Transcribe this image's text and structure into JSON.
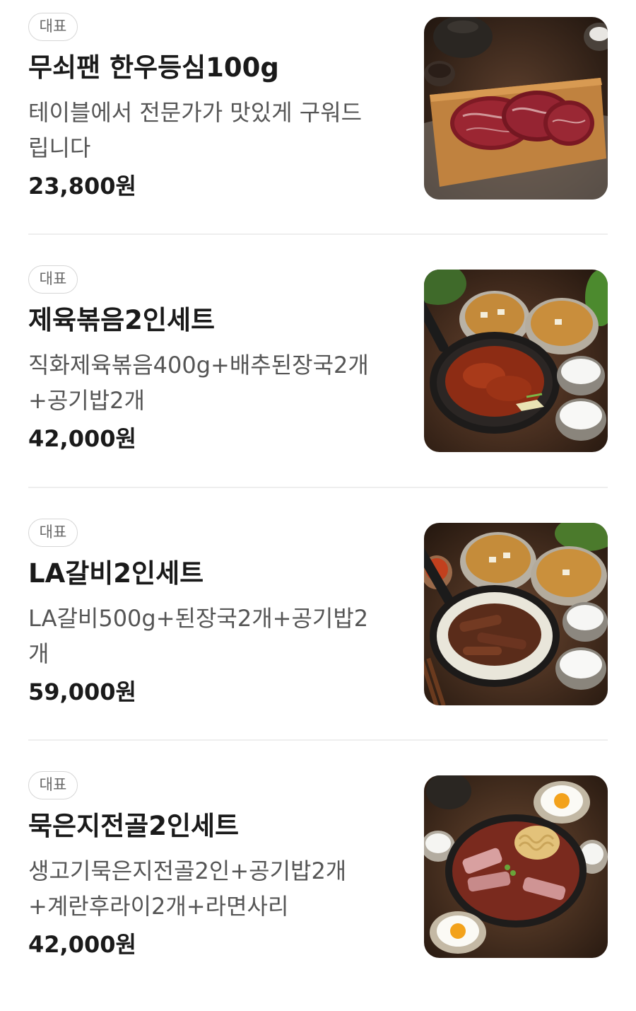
{
  "menu": {
    "items": [
      {
        "badge": "대표",
        "name": "무쇠팬 한우등심100g",
        "desc_lines": [
          "테이블에서 전문가가 맛있게 구워드",
          "립니다"
        ],
        "price": "23,800원",
        "image": "steak-on-wooden-board-image"
      },
      {
        "badge": "대표",
        "name": "제육볶음2인세트",
        "desc_lines": [
          "직화제육볶음400g+배추된장국2개",
          "+공기밥2개"
        ],
        "price": "42,000원",
        "image": "spicy-pork-pan-with-soup-and-rice-image"
      },
      {
        "badge": "대표",
        "name": "LA갈비2인세트",
        "desc_lines": [
          "LA갈비500g+된장국2개+공기밥2",
          "개"
        ],
        "price": "59,000원",
        "image": "la-galbi-pan-with-soup-and-rice-image"
      },
      {
        "badge": "대표",
        "name": "묵은지전골2인세트",
        "desc_lines": [
          "생고기묵은지전골2인+공기밥2개",
          "+계란후라이2개+라면사리"
        ],
        "price": "42,000원",
        "image": "kimchi-stew-pot-with-eggs-image"
      }
    ]
  }
}
